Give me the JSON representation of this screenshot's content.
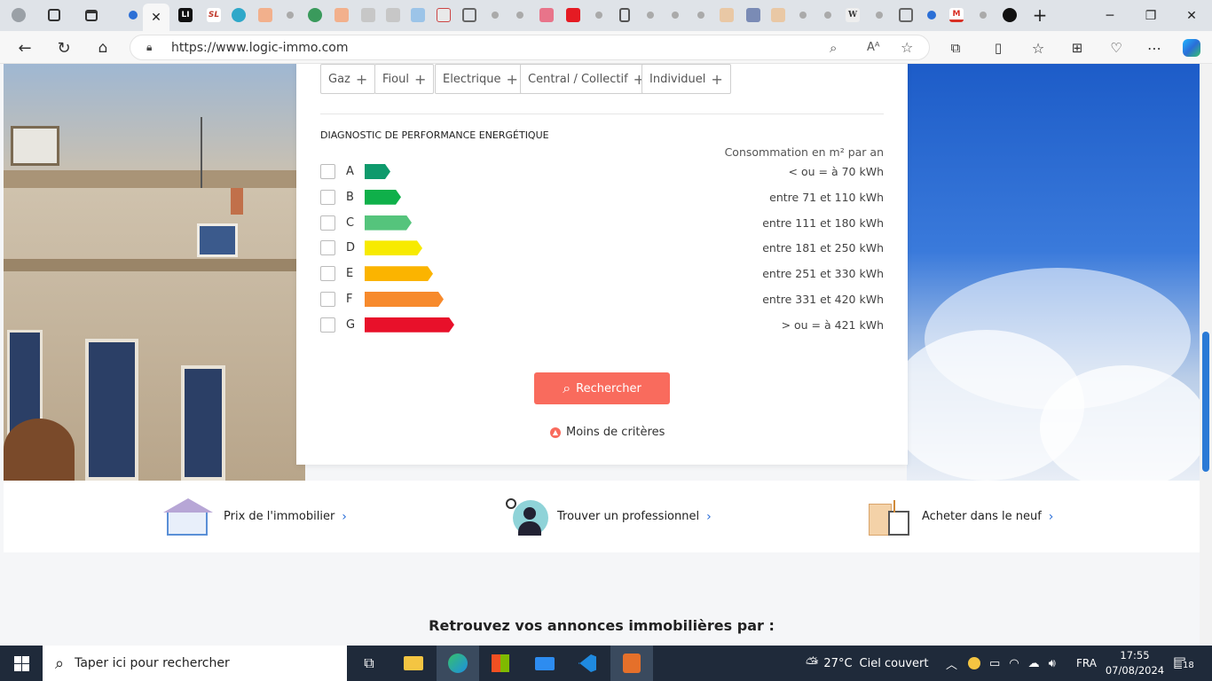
{
  "browser": {
    "url": "https://www.logic-immo.com",
    "read_aloud_label": "Aᴬ"
  },
  "filters": {
    "heating_chips": [
      "Gaz",
      "Fioul",
      "Electrique",
      "Central / Collectif",
      "Individuel"
    ]
  },
  "dpe": {
    "title": "DIAGNOSTIC DE PERFORMANCE ENERGÉTIQUE",
    "unit_label": "Consommation en m² par an",
    "rows": [
      {
        "letter": "A",
        "range": "< ou = à 70 kWh",
        "color": "#0e9a6c"
      },
      {
        "letter": "B",
        "range": "entre 71 et 110 kWh",
        "color": "#0fb04a"
      },
      {
        "letter": "C",
        "range": "entre 111 et 180 kWh",
        "color": "#55c47c"
      },
      {
        "letter": "D",
        "range": "entre 181 et 250 kWh",
        "color": "#f7ea00"
      },
      {
        "letter": "E",
        "range": "entre 251 et 330 kWh",
        "color": "#fbb400"
      },
      {
        "letter": "F",
        "range": "entre 331 et 420 kWh",
        "color": "#f78a2c"
      },
      {
        "letter": "G",
        "range": "> ou = à 421 kWh",
        "color": "#e8102a"
      }
    ]
  },
  "actions": {
    "search_label": "Rechercher",
    "less_criteria_label": "Moins de critères"
  },
  "quick_links": [
    {
      "label": "Prix de l'immobilier"
    },
    {
      "label": "Trouver un professionnel"
    },
    {
      "label": "Acheter dans le neuf"
    }
  ],
  "section": {
    "title": "Retrouvez vos annonces immobilières par :"
  },
  "taskbar": {
    "search_placeholder": "Taper ici pour rechercher",
    "weather_temp": "27°C",
    "weather_text": "Ciel couvert",
    "language": "FRA",
    "time": "17:55",
    "date": "07/08/2024",
    "notifications": "18"
  },
  "colors": {
    "accent": "#f96b5d",
    "link_chevron": "#2a6ed8"
  }
}
